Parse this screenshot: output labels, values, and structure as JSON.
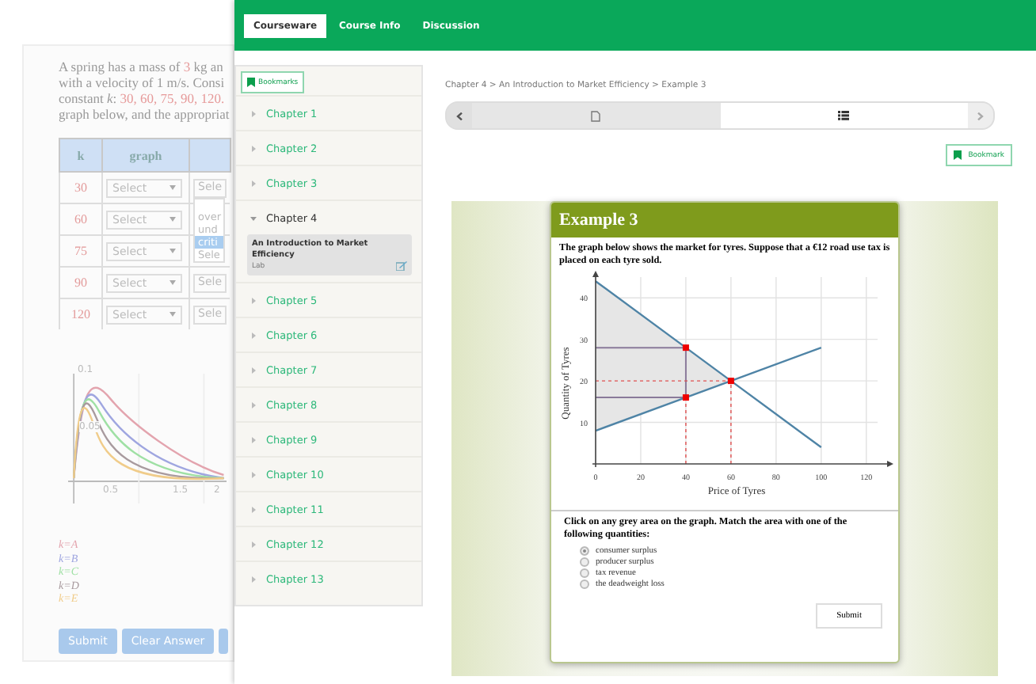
{
  "background_page": {
    "problem_lines": [
      [
        {
          "text": "A spring has a mass of ",
          "highlighted": false
        },
        {
          "text": "3",
          "highlighted": true
        },
        {
          "text": " kg an",
          "highlighted": false
        }
      ],
      [
        {
          "text": "with a velocity of 1 m/s. Consi",
          "highlighted": false
        }
      ],
      [
        {
          "text": "constant *k*: ",
          "highlighted": false
        },
        {
          "text": "30, 60, 75, 90, 120.",
          "highlighted": true
        }
      ],
      [
        {
          "text": "graph below, and the appropriat",
          "highlighted": false
        }
      ]
    ],
    "table": {
      "columns": [
        "k",
        "graph"
      ],
      "rows": [
        {
          "k": "30",
          "graph": "Select",
          "column_3": "Sele"
        },
        {
          "k": "60",
          "graph": "Select"
        },
        {
          "k": "75",
          "graph": "Select"
        },
        {
          "k": "90",
          "graph": "Select",
          "column_3": "Sele"
        },
        {
          "k": "120",
          "graph": "Select",
          "column_3": "Sele"
        }
      ],
      "open_dropdown": [
        {
          "label": "over",
          "selected": false
        },
        {
          "label": "und",
          "selected": false
        },
        {
          "label": "criti",
          "selected": true
        },
        {
          "label": "Sele",
          "selected": false
        }
      ]
    },
    "graph": {
      "y_tick_labels": [
        "0.1",
        "0.05"
      ],
      "x_tick_labels": [
        "0.5",
        "1.5",
        "2"
      ]
    },
    "legend": [
      {
        "label": "k=A",
        "color": "#e3a4ae"
      },
      {
        "label": "k=B",
        "color": "#9fa6e0"
      },
      {
        "label": "k=C",
        "color": "#9fe0a4"
      },
      {
        "label": "k=D",
        "color": "#a89a9e"
      },
      {
        "label": "k=E",
        "color": "#f0cc8a"
      }
    ],
    "buttons": [
      "Submit",
      "Clear Answer"
    ]
  },
  "nav_tabs": [
    {
      "label": "Courseware",
      "selected": true
    },
    {
      "label": "Course Info",
      "selected": false
    },
    {
      "label": "Discussion",
      "selected": false
    }
  ],
  "sidebar": {
    "bookmarks_button": "Bookmarks",
    "chapters": [
      {
        "label": "Chapter 1",
        "expanded": false
      },
      {
        "label": "Chapter 2",
        "expanded": false
      },
      {
        "label": "Chapter 3",
        "expanded": false
      },
      {
        "label": "Chapter 4",
        "expanded": true,
        "children": [
          {
            "title": "An Introduction to Market Efficiency",
            "type": "Lab",
            "selected": true
          }
        ]
      },
      {
        "label": "Chapter 5",
        "expanded": false
      },
      {
        "label": "Chapter 6",
        "expanded": false
      },
      {
        "label": "Chapter 7",
        "expanded": false
      },
      {
        "label": "Chapter 8",
        "expanded": false
      },
      {
        "label": "Chapter 9",
        "expanded": false
      },
      {
        "label": "Chapter 10",
        "expanded": false
      },
      {
        "label": "Chapter 11",
        "expanded": false
      },
      {
        "label": "Chapter 12",
        "expanded": false
      },
      {
        "label": "Chapter 13",
        "expanded": false
      }
    ]
  },
  "main": {
    "breadcrumb": "Chapter 4 > An Introduction to Market Efficiency > Example 3",
    "sequence_tabs": [
      {
        "kind": "document",
        "selected": false
      },
      {
        "kind": "list",
        "selected": true
      }
    ],
    "bookmark_button": "Bookmark",
    "example": {
      "title": "Example 3",
      "prompt": "The graph below shows the market for tyres. Suppose that a €12 road use tax is placed on each tyre sold.",
      "chart_data": {
        "type": "line",
        "xlabel": "Price of Tyres",
        "ylabel": "Quantity of Tyres",
        "x": [
          0,
          40,
          60,
          100
        ],
        "series": [
          {
            "color": "#4f84a6",
            "line_style": "solid",
            "values": [
              44,
              28,
              20,
              4
            ]
          },
          {
            "color": "#4f84a6",
            "line_style": "solid",
            "values": [
              8,
              16,
              20,
              28
            ]
          },
          {
            "color": "#8a7a9a",
            "line_style": "solid",
            "values": [
              28,
              28,
              null,
              null
            ]
          },
          {
            "color": "#8a7a9a",
            "line_style": "solid",
            "values": [
              16,
              16,
              null,
              null
            ]
          },
          {
            "color": "#e05050",
            "line_style": "dashed",
            "values": [
              20,
              20,
              20,
              null
            ]
          }
        ],
        "xlim": [
          0,
          125
        ],
        "ylim": [
          0,
          45
        ],
        "xticks": [
          0,
          20,
          40,
          60,
          80,
          100,
          120
        ],
        "yticks": [
          10,
          20,
          30,
          40
        ],
        "grid": true,
        "ref_lines": [
          {
            "axis": "x",
            "value": 40,
            "color": "#e05050",
            "line_style": "dashed"
          },
          {
            "axis": "x",
            "value": 60,
            "color": "#e05050",
            "line_style": "dashed"
          }
        ]
      },
      "question": "Click on any grey area on the graph. Match the area with one of the following quantities:",
      "options": [
        {
          "label": "consumer surplus",
          "selected": true
        },
        {
          "label": "producer surplus",
          "selected": false
        },
        {
          "label": "tax revenue",
          "selected": false
        },
        {
          "label": "the deadweight loss",
          "selected": false
        }
      ],
      "submit_button": "Submit"
    }
  }
}
